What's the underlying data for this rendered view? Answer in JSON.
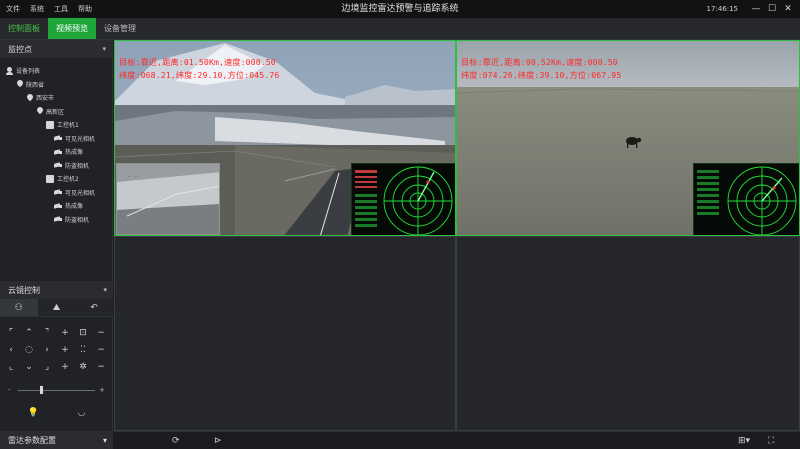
{
  "menu": [
    "文件",
    "系统",
    "工具",
    "帮助"
  ],
  "app_title": "边境监控雷达预警与追踪系统",
  "clock": "17:46:15",
  "window_buttons": {
    "minimize": "—",
    "maximize": "☐",
    "close": "✕"
  },
  "tabs": [
    {
      "label": "控制面板",
      "state": "green-text"
    },
    {
      "label": "视频预览",
      "state": "active"
    },
    {
      "label": "设备管理",
      "state": "normal"
    }
  ],
  "tree": {
    "title": "监控点",
    "root": "设备列表",
    "province": "陕西省",
    "city": "西安市",
    "district": "高新区",
    "machines": [
      {
        "name": "工控机1",
        "cameras": [
          "可见光相机",
          "热成像",
          "防盗相机"
        ]
      },
      {
        "name": "工控机2",
        "cameras": [
          "可见光相机",
          "热成像",
          "防盗相机"
        ]
      }
    ]
  },
  "ptz": {
    "title": "云镜控制",
    "tab_icons": [
      "ptz-person-icon",
      "preset-icon",
      "cruise-icon"
    ],
    "grid": [
      "⌜",
      "⌃",
      "⌝",
      "+",
      "⊡",
      "−",
      "‹",
      "◌",
      "›",
      "+",
      "⁚⁚",
      "−",
      "⌞",
      "⌄",
      "⌟",
      "+",
      "✲",
      "−"
    ],
    "slider_minus": "-",
    "slider_plus": "+",
    "slider_value": 0.3
  },
  "radar_params_title": "雷达参数配置",
  "videos": [
    {
      "line1": "目标:靠近,距离:01.50Km,速度:000.50",
      "line2": "纬度:068.21,纬度:29.10,方位:045.76"
    },
    {
      "line1": "目标:靠近,距离:00.52Km,速度:000.50",
      "line2": "纬度:074.26,纬度:39.10,方位:067.95"
    }
  ],
  "colors": {
    "accent": "#1fa63a",
    "overlay_text": "#ff2a2a",
    "radar": "#22e03a"
  },
  "bottom_icons": [
    "refresh-icon",
    "play-icon",
    "layout-icon",
    "fullscreen-icon"
  ]
}
